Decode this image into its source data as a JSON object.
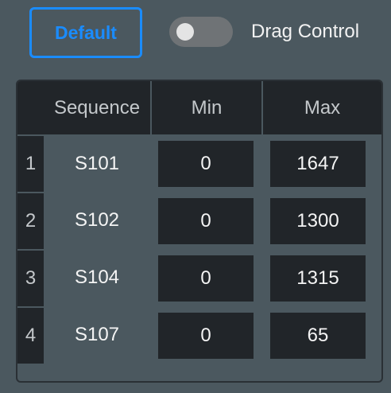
{
  "controls": {
    "default_label": "Default",
    "toggle_label": "Drag Control",
    "toggle_on": false
  },
  "table": {
    "headers": {
      "index": "",
      "sequence": "Sequence",
      "min": "Min",
      "max": "Max"
    },
    "rows": [
      {
        "index": "1",
        "sequence": "S101",
        "min": "0",
        "max": "1647"
      },
      {
        "index": "2",
        "sequence": "S102",
        "min": "0",
        "max": "1300"
      },
      {
        "index": "3",
        "sequence": "S104",
        "min": "0",
        "max": "1315"
      },
      {
        "index": "4",
        "sequence": "S107",
        "min": "0",
        "max": "65"
      }
    ]
  },
  "colors": {
    "background": "#4b585f",
    "accent": "#1a8cff",
    "cell_dark": "#212529",
    "toggle_off": "#6f7376"
  }
}
